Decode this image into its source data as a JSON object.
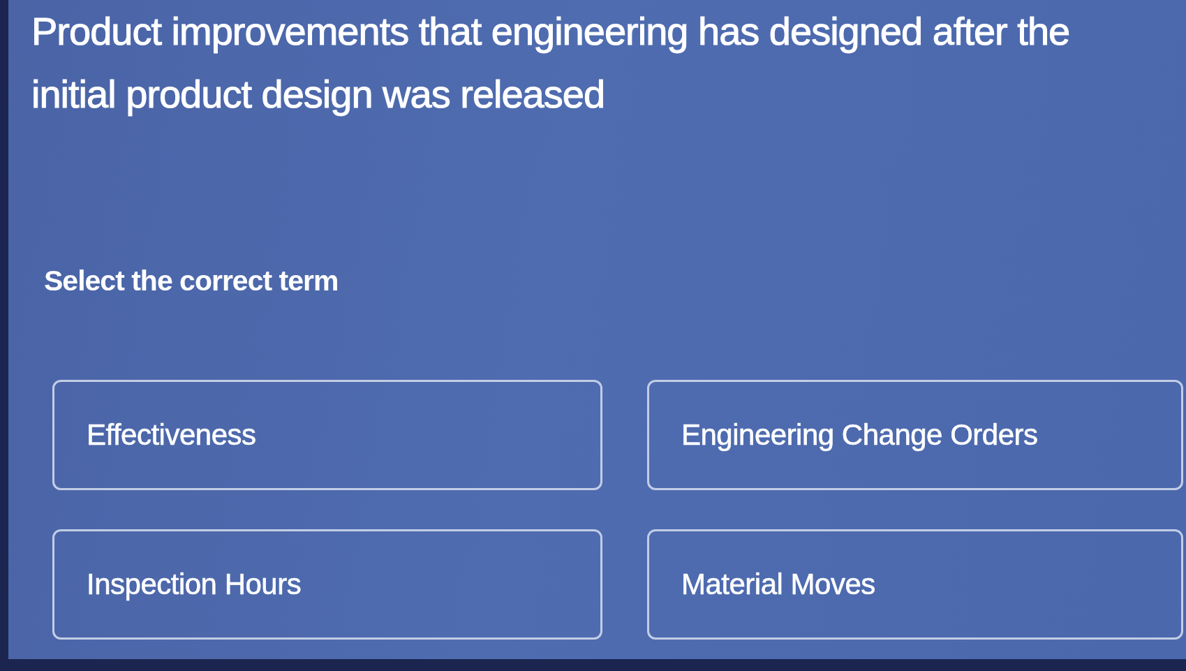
{
  "question": {
    "text": "Product improvements that engineering has designed after the initial product design was released"
  },
  "prompt": "Select the correct term",
  "options": [
    {
      "label": "Effectiveness",
      "selected": false
    },
    {
      "label": "Engineering Change Orders",
      "selected": false
    },
    {
      "label": "Inspection Hours",
      "selected": false
    },
    {
      "label": "Material Moves",
      "selected": false
    }
  ]
}
